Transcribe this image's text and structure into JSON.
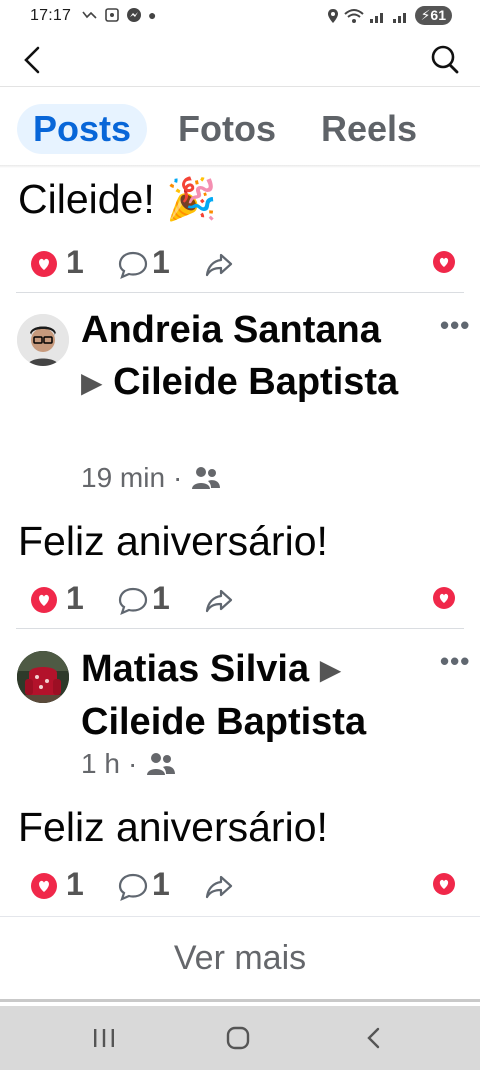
{
  "status": {
    "time": "17:17",
    "battery": "61"
  },
  "tabs": [
    {
      "label": "Posts",
      "active": true
    },
    {
      "label": "Fotos",
      "active": false
    },
    {
      "label": "Reels",
      "active": false
    }
  ],
  "posts": [
    {
      "text": "Cileide! 🎉",
      "reactions": "1",
      "comments": "1"
    },
    {
      "author": "Andreia Santana",
      "arrow": "▶",
      "target": "Cileide Baptista",
      "time": "19 min",
      "text": "Feliz aniversário!",
      "reactions": "1",
      "comments": "1"
    },
    {
      "author": "Matias Silvia",
      "arrow": "▶",
      "target": "Cileide Baptista",
      "time": "1 h",
      "text": "Feliz aniversário!",
      "reactions": "1",
      "comments": "1"
    }
  ],
  "footer": {
    "see_more": "Ver mais"
  },
  "icons": {
    "back": "back-arrow-icon",
    "search": "search-icon",
    "heart": "heart-reaction-icon",
    "comment": "comment-icon",
    "share": "share-icon",
    "friends": "friends-icon",
    "more": "more-options-icon"
  },
  "colors": {
    "accent": "#0866d8",
    "heart": "#f0284a",
    "tab_active_bg": "#e7f3ff"
  }
}
